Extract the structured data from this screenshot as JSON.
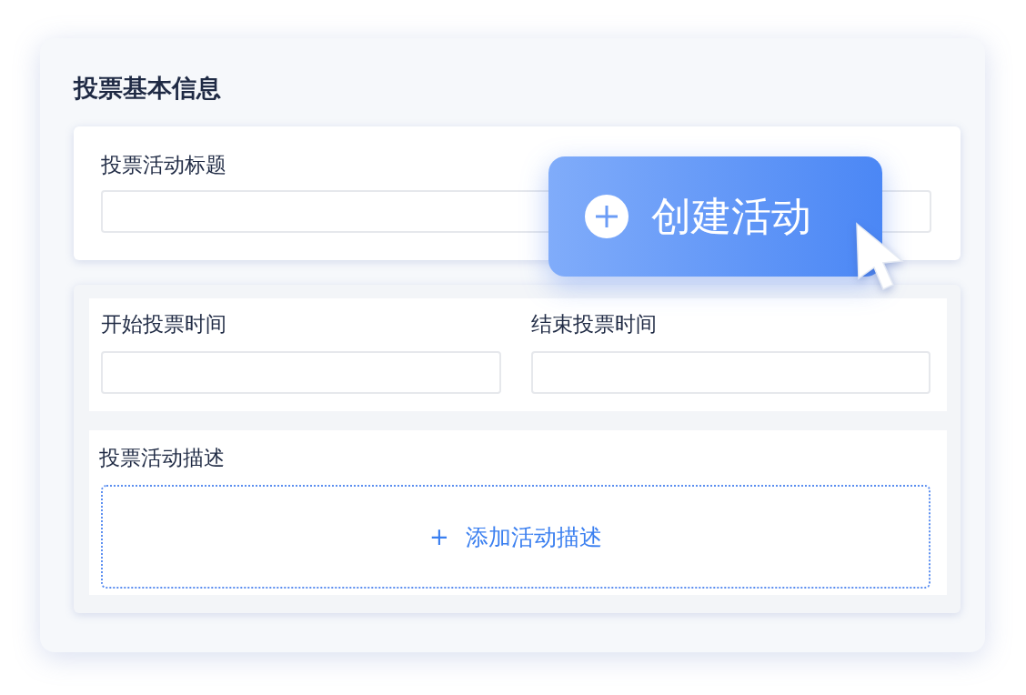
{
  "section_title": "投票基本信息",
  "title_field": {
    "label": "投票活动标题"
  },
  "time_fields": [
    {
      "label": "开始投票时间"
    },
    {
      "label": "结束投票时间"
    }
  ],
  "description": {
    "label": "投票活动描述",
    "add_icon": "+",
    "add_label": "添加活动描述"
  },
  "create_button": {
    "label": "创建活动"
  }
}
